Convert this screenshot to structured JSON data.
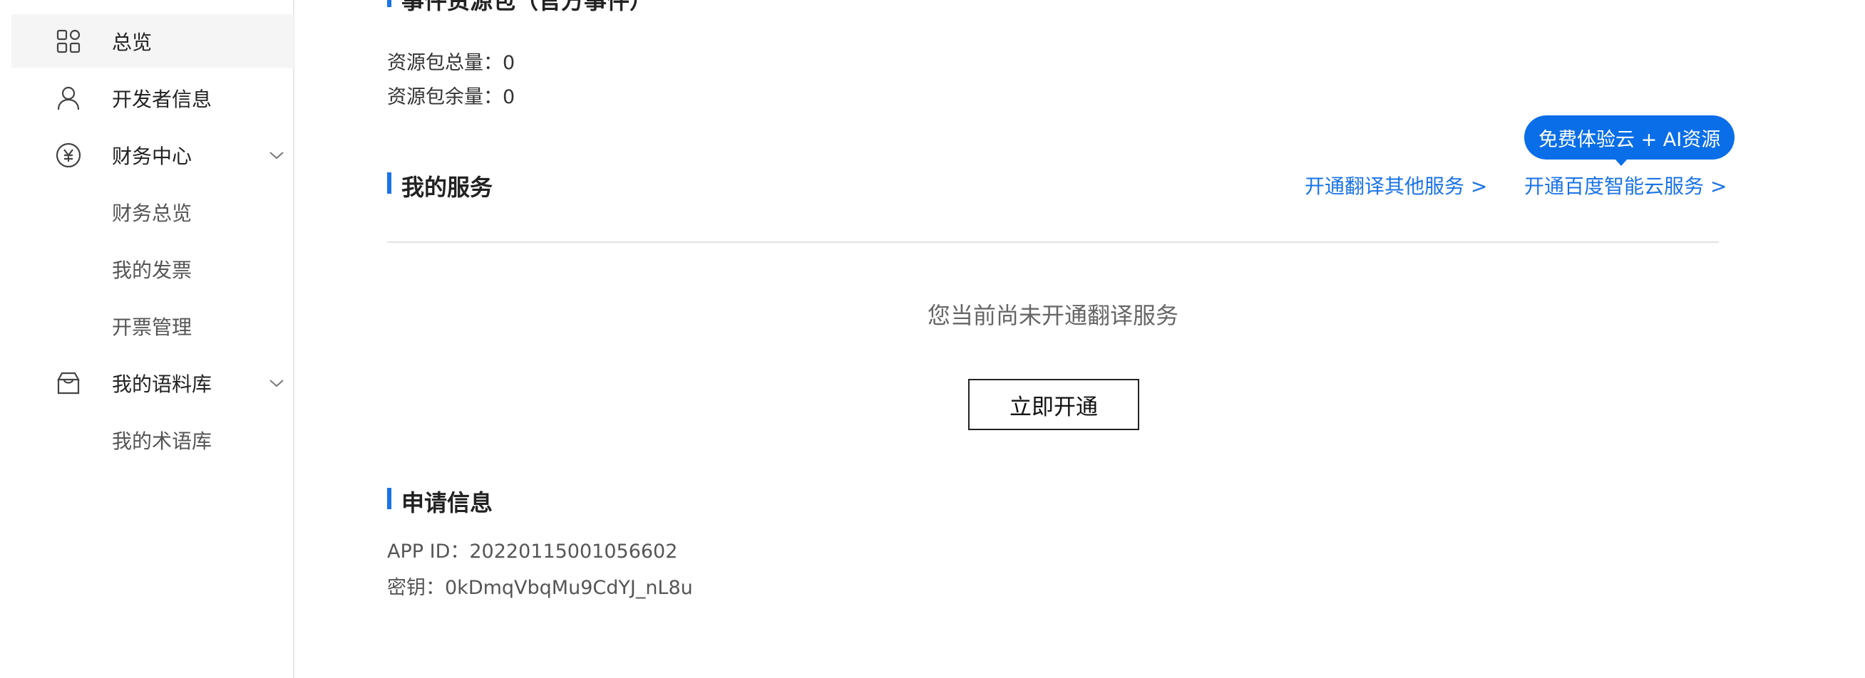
{
  "sidebar": {
    "items": [
      {
        "label": "总览",
        "icon": "grid-icon",
        "active": true
      },
      {
        "label": "开发者信息",
        "icon": "user-icon"
      },
      {
        "label": "财务中心",
        "icon": "yen-circle-icon",
        "expandable": true
      },
      {
        "label": "财务总览",
        "sub": true
      },
      {
        "label": "我的发票",
        "sub": true
      },
      {
        "label": "开票管理",
        "sub": true
      },
      {
        "label": "我的语料库",
        "icon": "inbox-icon",
        "expandable": true
      },
      {
        "label": "我的术语库",
        "sub": true
      }
    ]
  },
  "resource": {
    "section_title": "事件资源包（官方事件）",
    "total_label": "资源包总量：",
    "total_value": "0",
    "remaining_label": "资源包余量：",
    "remaining_value": "0"
  },
  "services": {
    "title": "我的服务",
    "link_other": "开通翻译其他服务 >",
    "link_cloud": "开通百度智能云服务 >",
    "promo_pill": "免费体验云 + AI资源",
    "empty_message": "您当前尚未开通翻译服务",
    "open_button": "立即开通"
  },
  "application": {
    "title": "申请信息",
    "app_id_label": "APP ID：",
    "app_id_value": "20220115001056602",
    "key_label": "密钥：",
    "key_value": "0kDmqVbqMu9CdYJ_nL8u"
  },
  "colors": {
    "accent": "#1a73e8",
    "pill": "#0a6ee8"
  }
}
